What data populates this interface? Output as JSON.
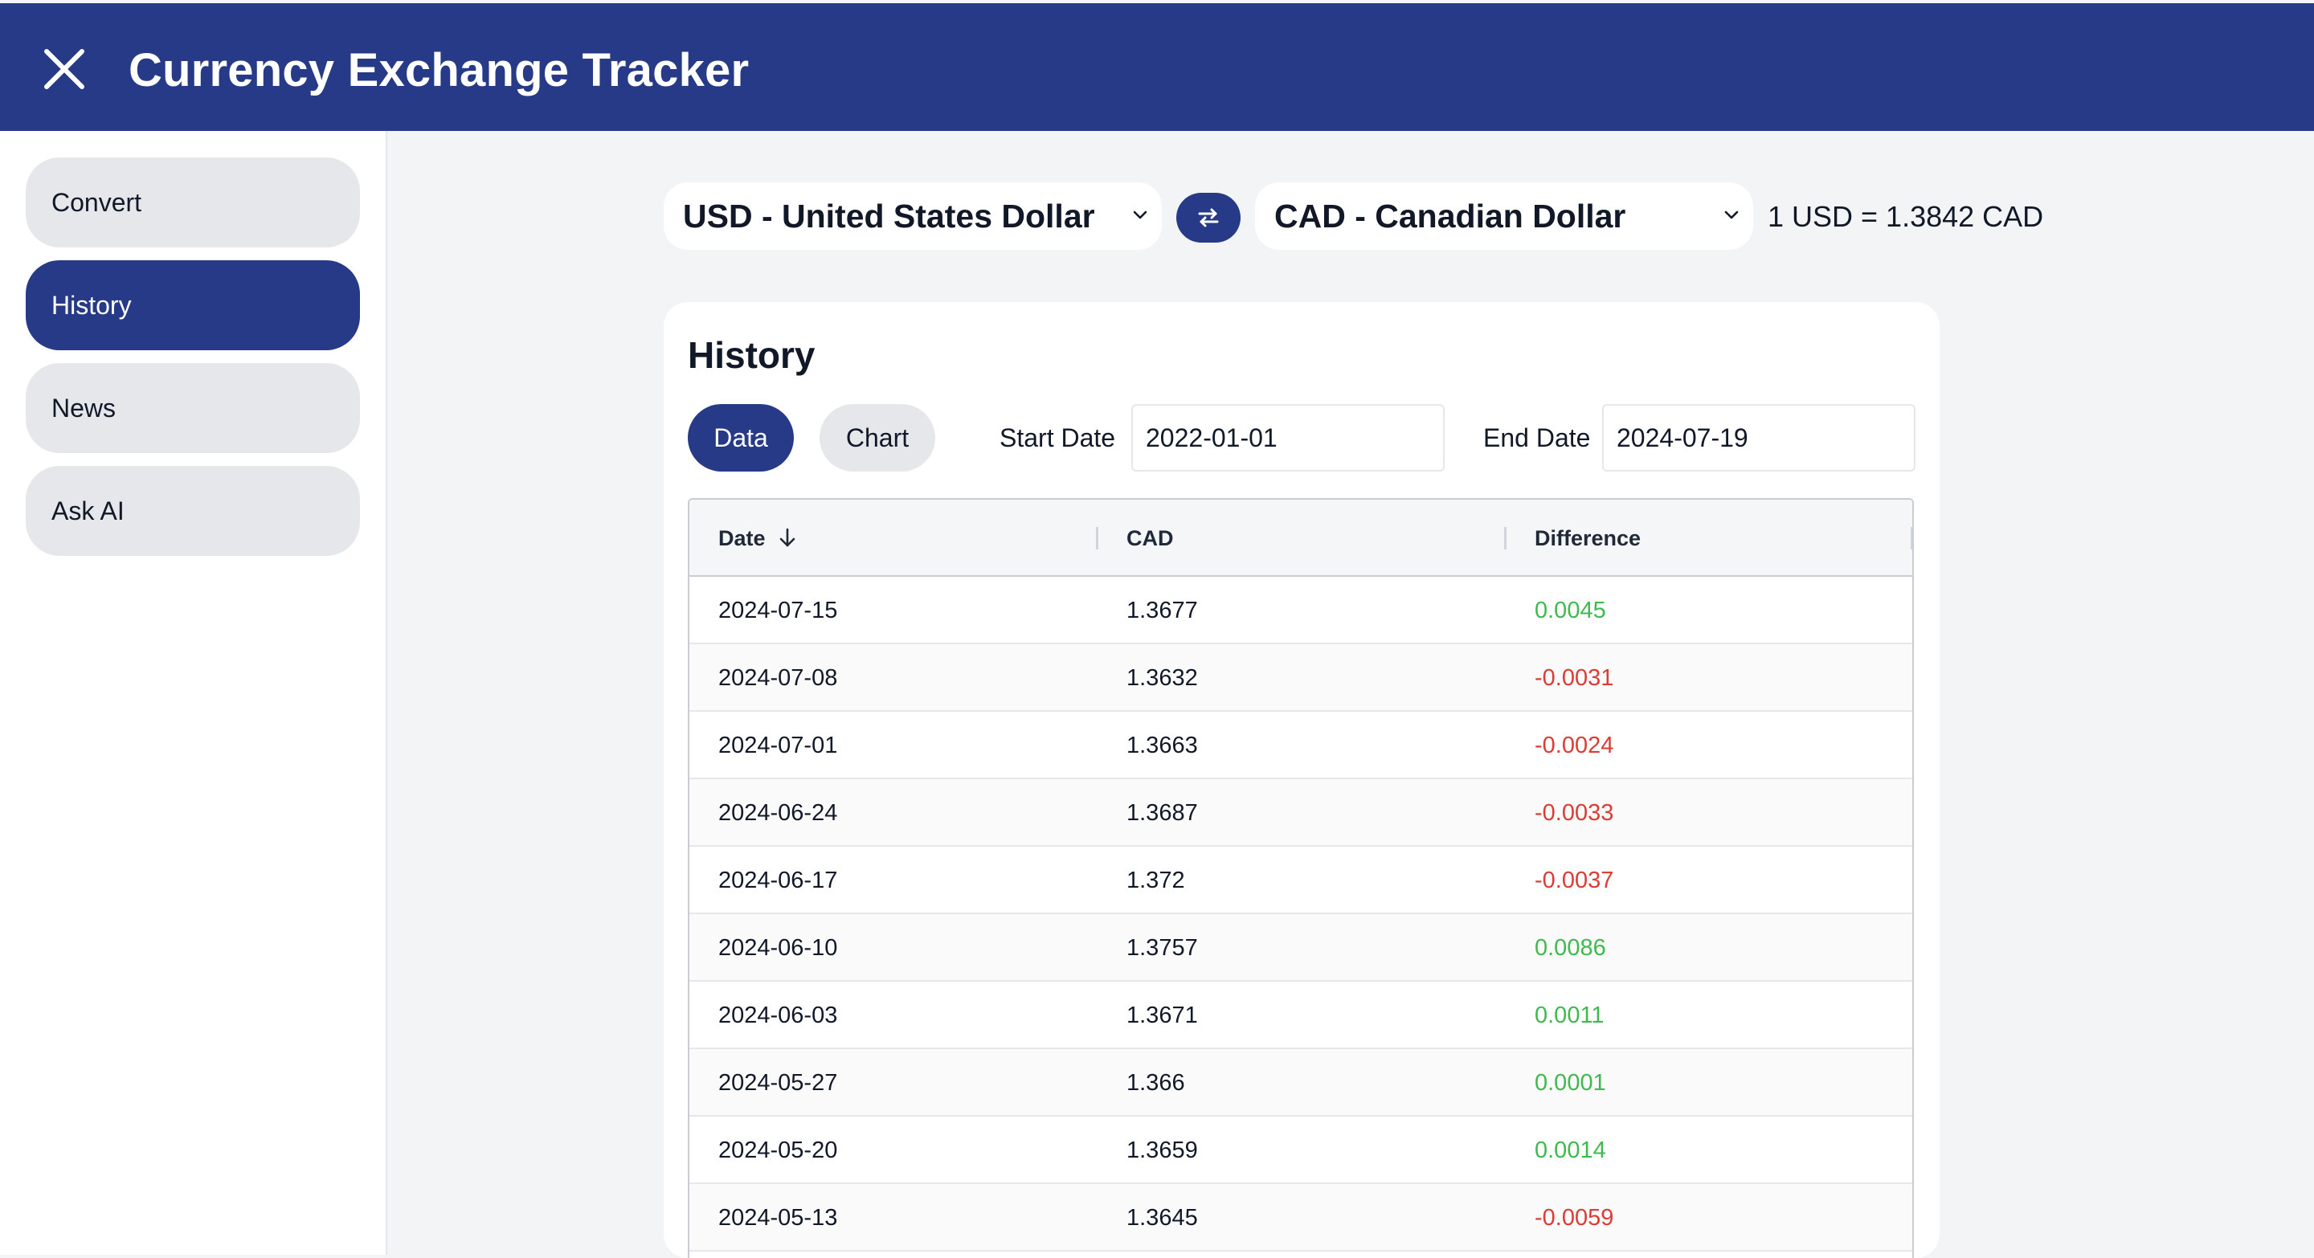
{
  "app": {
    "title": "Currency Exchange Tracker"
  },
  "header": {
    "close_icon": "close-icon"
  },
  "sidebar": {
    "items": [
      {
        "label": "Convert",
        "active": false
      },
      {
        "label": "History",
        "active": true
      },
      {
        "label": "News",
        "active": false
      },
      {
        "label": "Ask AI",
        "active": false
      }
    ]
  },
  "currency": {
    "from": "USD - United States Dollar",
    "to": "CAD - Canadian Dollar",
    "swap_icon": "swap-arrows-icon",
    "rate": "1 USD = 1.3842 CAD"
  },
  "history": {
    "title": "History",
    "tabs": [
      {
        "label": "Data",
        "active": true
      },
      {
        "label": "Chart",
        "active": false
      }
    ],
    "start_label": "Start Date",
    "start_value": "2022-01-01",
    "end_label": "End Date",
    "end_value": "2024-07-19",
    "columns": [
      "Date",
      "CAD",
      "Difference"
    ],
    "sort_icon": "arrow-down-icon",
    "rows": [
      {
        "date": "2024-07-15",
        "value": "1.3677",
        "diff": "0.0045"
      },
      {
        "date": "2024-07-08",
        "value": "1.3632",
        "diff": "-0.0031"
      },
      {
        "date": "2024-07-01",
        "value": "1.3663",
        "diff": "-0.0024"
      },
      {
        "date": "2024-06-24",
        "value": "1.3687",
        "diff": "-0.0033"
      },
      {
        "date": "2024-06-17",
        "value": "1.372",
        "diff": "-0.0037"
      },
      {
        "date": "2024-06-10",
        "value": "1.3757",
        "diff": "0.0086"
      },
      {
        "date": "2024-06-03",
        "value": "1.3671",
        "diff": "0.0011"
      },
      {
        "date": "2024-05-27",
        "value": "1.366",
        "diff": "0.0001"
      },
      {
        "date": "2024-05-20",
        "value": "1.3659",
        "diff": "0.0014"
      },
      {
        "date": "2024-05-13",
        "value": "1.3645",
        "diff": "-0.0059"
      }
    ]
  },
  "colors": {
    "brand": "#263a87",
    "positive": "#3fb950",
    "negative": "#dc3b36",
    "background": "#f3f4f6"
  }
}
